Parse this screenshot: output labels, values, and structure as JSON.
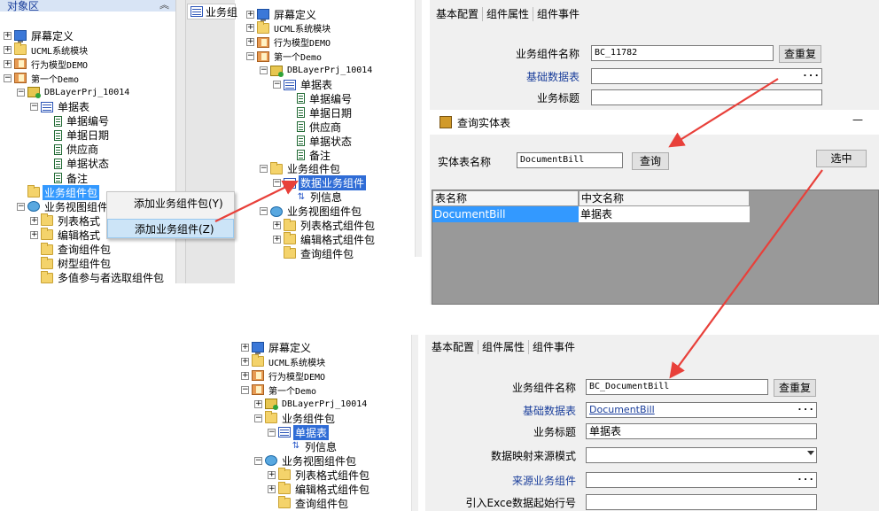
{
  "colors": {
    "arrow": "#e8403a",
    "selection": "#3399ff",
    "link": "#1a3e9b"
  },
  "panel1": {
    "header": "对象区",
    "collapse_icon": "double-chevron-up-icon",
    "tree": [
      {
        "label": "屏幕定义",
        "icon": "screen-icon"
      },
      {
        "label": "UCML系统模块",
        "icon": "folder-icon"
      },
      {
        "label": "行为模型DEMO",
        "icon": "book-icon"
      },
      {
        "label": "第一个Demo",
        "icon": "book-icon"
      },
      {
        "label": "DBLayerPrj_10014",
        "icon": "project-icon"
      },
      {
        "label": "单据表",
        "icon": "table-icon"
      },
      {
        "label": "单据编号",
        "icon": "field-icon"
      },
      {
        "label": "单据日期",
        "icon": "field-icon"
      },
      {
        "label": "供应商",
        "icon": "field-icon"
      },
      {
        "label": "单据状态",
        "icon": "field-icon"
      },
      {
        "label": "备注",
        "icon": "field-icon"
      },
      {
        "label": "业务组件包",
        "icon": "folder-icon"
      },
      {
        "label": "业务视图组件",
        "icon": "globe-icon"
      },
      {
        "label": "列表格式",
        "icon": "folder-icon"
      },
      {
        "label": "编辑格式",
        "icon": "folder-icon"
      },
      {
        "label": "查询组件包",
        "icon": "folder-icon"
      },
      {
        "label": "树型组件包",
        "icon": "folder-icon"
      },
      {
        "label": "多值参与者选取组件包",
        "icon": "folder-icon"
      }
    ],
    "tab_label": "业务组"
  },
  "context_menu": {
    "items": [
      "添加业务组件包(Y)",
      "添加业务组件(Z)"
    ]
  },
  "panel2": {
    "tree": [
      {
        "label": "屏幕定义"
      },
      {
        "label": "UCML系统模块"
      },
      {
        "label": "行为模型DEMO"
      },
      {
        "label": "第一个Demo"
      },
      {
        "label": "DBLayerPrj_10014"
      },
      {
        "label": "单据表"
      },
      {
        "label": "单据编号"
      },
      {
        "label": "单据日期"
      },
      {
        "label": "供应商"
      },
      {
        "label": "单据状态"
      },
      {
        "label": "备注"
      },
      {
        "label": "业务组件包"
      },
      {
        "label": "数据业务组件"
      },
      {
        "label": "列信息"
      },
      {
        "label": "业务视图组件包"
      },
      {
        "label": "列表格式组件包"
      },
      {
        "label": "编辑格式组件包"
      },
      {
        "label": "查询组件包"
      }
    ]
  },
  "panel3": {
    "tabs": [
      "基本配置",
      "组件属性",
      "组件事件"
    ],
    "fields": {
      "component_name_label": "业务组件名称",
      "component_name_value": "BC_11782",
      "reset_button": "查重复",
      "base_table_label": "基础数据表",
      "base_table_value": "",
      "title_label": "业务标题",
      "title_value": ""
    }
  },
  "dialog": {
    "title": "查询实体表",
    "close": "—",
    "entity_label": "实体表名称",
    "entity_value": "DocumentBill",
    "query_button": "查询",
    "select_button": "选中",
    "grid": {
      "columns": [
        "表名称",
        "中文名称"
      ],
      "rows": [
        [
          "DocumentBill",
          "单据表"
        ]
      ]
    }
  },
  "panel4": {
    "tree": [
      {
        "label": "屏幕定义"
      },
      {
        "label": "UCML系统模块"
      },
      {
        "label": "行为模型DEMO"
      },
      {
        "label": "第一个Demo"
      },
      {
        "label": "DBLayerPrj_10014"
      },
      {
        "label": "业务组件包"
      },
      {
        "label": "单据表"
      },
      {
        "label": "列信息"
      },
      {
        "label": "业务视图组件包"
      },
      {
        "label": "列表格式组件包"
      },
      {
        "label": "编辑格式组件包"
      },
      {
        "label": "查询组件包"
      }
    ]
  },
  "panel5": {
    "tabs": [
      "基本配置",
      "组件属性",
      "组件事件"
    ],
    "fields": {
      "component_name_label": "业务组件名称",
      "component_name_value": "BC_DocumentBill",
      "reset_button": "查重复",
      "base_table_label": "基础数据表",
      "base_table_value": "DocumentBill",
      "title_label": "业务标题",
      "title_value": "单据表",
      "mapping_label": "数据映射来源模式",
      "mapping_value": "",
      "source_label": "来源业务组件",
      "source_value": "",
      "excel_label": "引入Exce数据起始行号",
      "excel_value": ""
    }
  }
}
